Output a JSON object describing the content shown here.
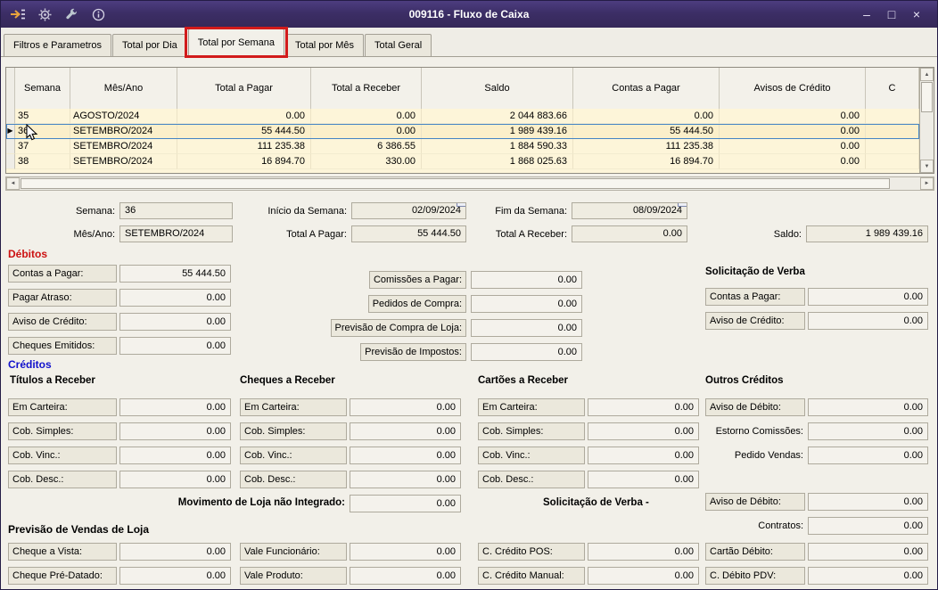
{
  "window": {
    "title": "009116 - Fluxo de Caixa",
    "controls": {
      "minimize": "–",
      "maximize": "□",
      "close": "×"
    }
  },
  "tabs": [
    "Filtros e Parametros",
    "Total por Dia",
    "Total por Semana",
    "Total por Mês",
    "Total Geral"
  ],
  "icons": {
    "up": "▲",
    "down": "▼",
    "left": "◄",
    "right": "►",
    "row_marker": "▶"
  },
  "grid": {
    "columns": [
      "Semana",
      "Mês/Ano",
      "Total a Pagar",
      "Total a Receber",
      "Saldo",
      "Contas a Pagar",
      "Avisos de Crédito",
      "C"
    ],
    "rows": [
      [
        "35",
        "AGOSTO/2024",
        "0.00",
        "0.00",
        "2 044 883.66",
        "0.00",
        "0.00"
      ],
      [
        "36",
        "SETEMBRO/2024",
        "55 444.50",
        "0.00",
        "1 989 439.16",
        "55 444.50",
        "0.00"
      ],
      [
        "37",
        "SETEMBRO/2024",
        "111 235.38",
        "6 386.55",
        "1 884 590.33",
        "111 235.38",
        "0.00"
      ],
      [
        "38",
        "SETEMBRO/2024",
        "16 894.70",
        "330.00",
        "1 868 025.63",
        "16 894.70",
        "0.00"
      ]
    ]
  },
  "summary": {
    "semana": {
      "label": "Semana:",
      "value": "36"
    },
    "inicio": {
      "label": "Início da Semana:",
      "value": "02/09/2024"
    },
    "fim": {
      "label": "Fim da Semana:",
      "value": "08/09/2024"
    },
    "mes_ano": {
      "label": "Mês/Ano:",
      "value": "SETEMBRO/2024"
    },
    "total_pagar": {
      "label": "Total A Pagar:",
      "value": "55 444.50"
    },
    "total_receber": {
      "label": "Total A Receber:",
      "value": "0.00"
    },
    "saldo": {
      "label": "Saldo:",
      "value": "1 989 439.16"
    }
  },
  "debitos": {
    "title": "Débitos",
    "left": [
      {
        "label": "Contas a Pagar:",
        "value": "55 444.50"
      },
      {
        "label": "Pagar Atraso:",
        "value": "0.00"
      },
      {
        "label": "Aviso de Crédito:",
        "value": "0.00"
      },
      {
        "label": "Cheques Emitidos:",
        "value": "0.00"
      }
    ],
    "middle": [
      {
        "label": "Comissões a Pagar:",
        "value": "0.00"
      },
      {
        "label": "Pedidos de Compra:",
        "value": "0.00"
      },
      {
        "label": "Previsão de Compra de Loja:",
        "value": "0.00"
      },
      {
        "label": "Previsão de Impostos:",
        "value": "0.00"
      }
    ],
    "verba": {
      "title": "Solicitação de Verba",
      "rows": [
        {
          "label": "Contas a Pagar:",
          "value": "0.00"
        },
        {
          "label": "Aviso de Crédito:",
          "value": "0.00"
        }
      ]
    }
  },
  "creditos": {
    "title": "Créditos",
    "groups": [
      {
        "title": "Títulos a Receber",
        "rows": [
          {
            "label": "Em Carteira:",
            "value": "0.00"
          },
          {
            "label": "Cob. Simples:",
            "value": "0.00"
          },
          {
            "label": "Cob. Vinc.:",
            "value": "0.00"
          },
          {
            "label": "Cob. Desc.:",
            "value": "0.00"
          }
        ]
      },
      {
        "title": "Cheques a Receber",
        "rows": [
          {
            "label": "Em Carteira:",
            "value": "0.00"
          },
          {
            "label": "Cob. Simples:",
            "value": "0.00"
          },
          {
            "label": "Cob. Vinc.:",
            "value": "0.00"
          },
          {
            "label": "Cob. Desc.:",
            "value": "0.00"
          }
        ]
      },
      {
        "title": "Cartões a Receber",
        "rows": [
          {
            "label": "Em Carteira:",
            "value": "0.00"
          },
          {
            "label": "Cob. Simples:",
            "value": "0.00"
          },
          {
            "label": "Cob. Vinc.:",
            "value": "0.00"
          },
          {
            "label": "Cob. Desc.:",
            "value": "0.00"
          }
        ]
      }
    ],
    "outros": {
      "title": "Outros Créditos",
      "rows": [
        {
          "label": "Aviso de Débito:",
          "value": "0.00"
        },
        {
          "label": "Estorno Comissões:",
          "value": "0.00"
        },
        {
          "label": "Pedido Vendas:",
          "value": "0.00"
        }
      ]
    },
    "movimento": {
      "label": "Movimento de Loja não Integrado:",
      "value": "0.00"
    },
    "verba_title": "Solicitação de Verba -",
    "verba_aviso": {
      "label": "Aviso de Débito:",
      "value": "0.00"
    },
    "contratos": {
      "label": "Contratos:",
      "value": "0.00"
    }
  },
  "previsao": {
    "title": "Previsão de Vendas de Loja",
    "rows": [
      {
        "label": "Cheque a Vista:",
        "value": "0.00"
      },
      {
        "label": "Cheque Pré-Datado:",
        "value": "0.00"
      },
      {
        "label": "Vale Funcionário:",
        "value": "0.00"
      },
      {
        "label": "Vale Produto:",
        "value": "0.00"
      },
      {
        "label": "C. Crédito POS:",
        "value": "0.00"
      },
      {
        "label": "C. Crédito Manual:",
        "value": "0.00"
      },
      {
        "label": "Cartão Débito:",
        "value": "0.00"
      },
      {
        "label": "C. Débito PDV:",
        "value": "0.00"
      }
    ]
  },
  "colors": {
    "titlebar": "#3c2e66",
    "annotation": "#d21b1b",
    "grid_row_bg": "#fdf5d9",
    "selection": "#4484c4",
    "debitos": "#cc1111",
    "creditos": "#1111cc"
  }
}
